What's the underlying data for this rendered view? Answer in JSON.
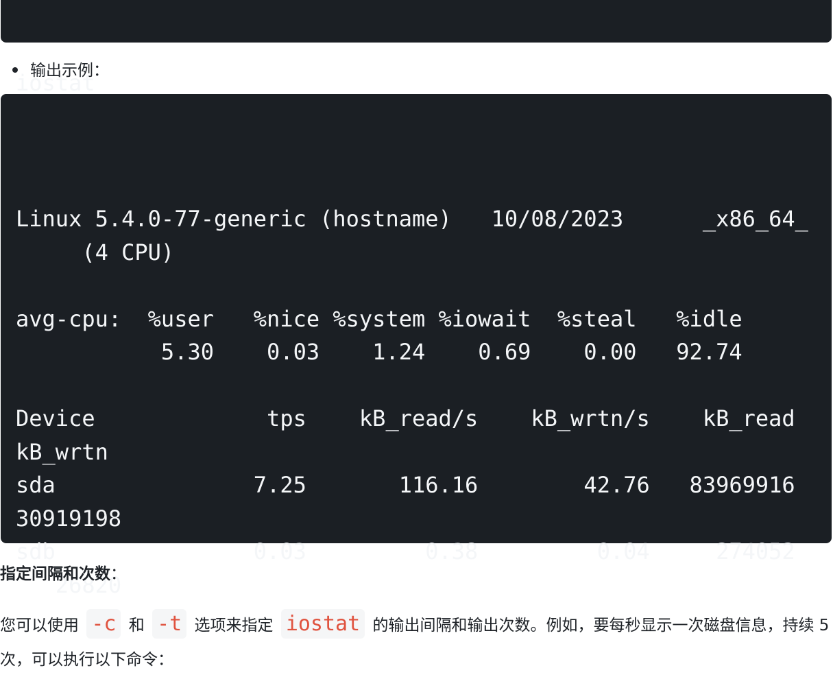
{
  "code_block_1": {
    "text": "iostat"
  },
  "bullet": {
    "text": "输出示例："
  },
  "code_block_2": {
    "text": "Linux 5.4.0-77-generic (hostname)   10/08/2023      _x86_64_\n     (4 CPU)\n\navg-cpu:  %user   %nice %system %iowait  %steal   %idle\n           5.30    0.03    1.24    0.69    0.00   92.74\n\nDevice             tps    kB_read/s    kB_wrtn/s    kB_read\nkB_wrtn\nsda               7.25       116.16        42.76   83969916\n30919198\nsdb               0.03         0.38         0.04     274052\n   26820"
  },
  "section": {
    "heading": "指定间隔和次数",
    "colon": "："
  },
  "paragraph": {
    "part1": "您可以使用",
    "code1": "-c",
    "part2": "和",
    "code2": "-t",
    "part3": "选项来指定",
    "code3": "iostat",
    "part4": "的输出间隔和输出次数。例如，要每秒显示一次磁盘信息，持续 5 次，可以执行以下命令："
  }
}
